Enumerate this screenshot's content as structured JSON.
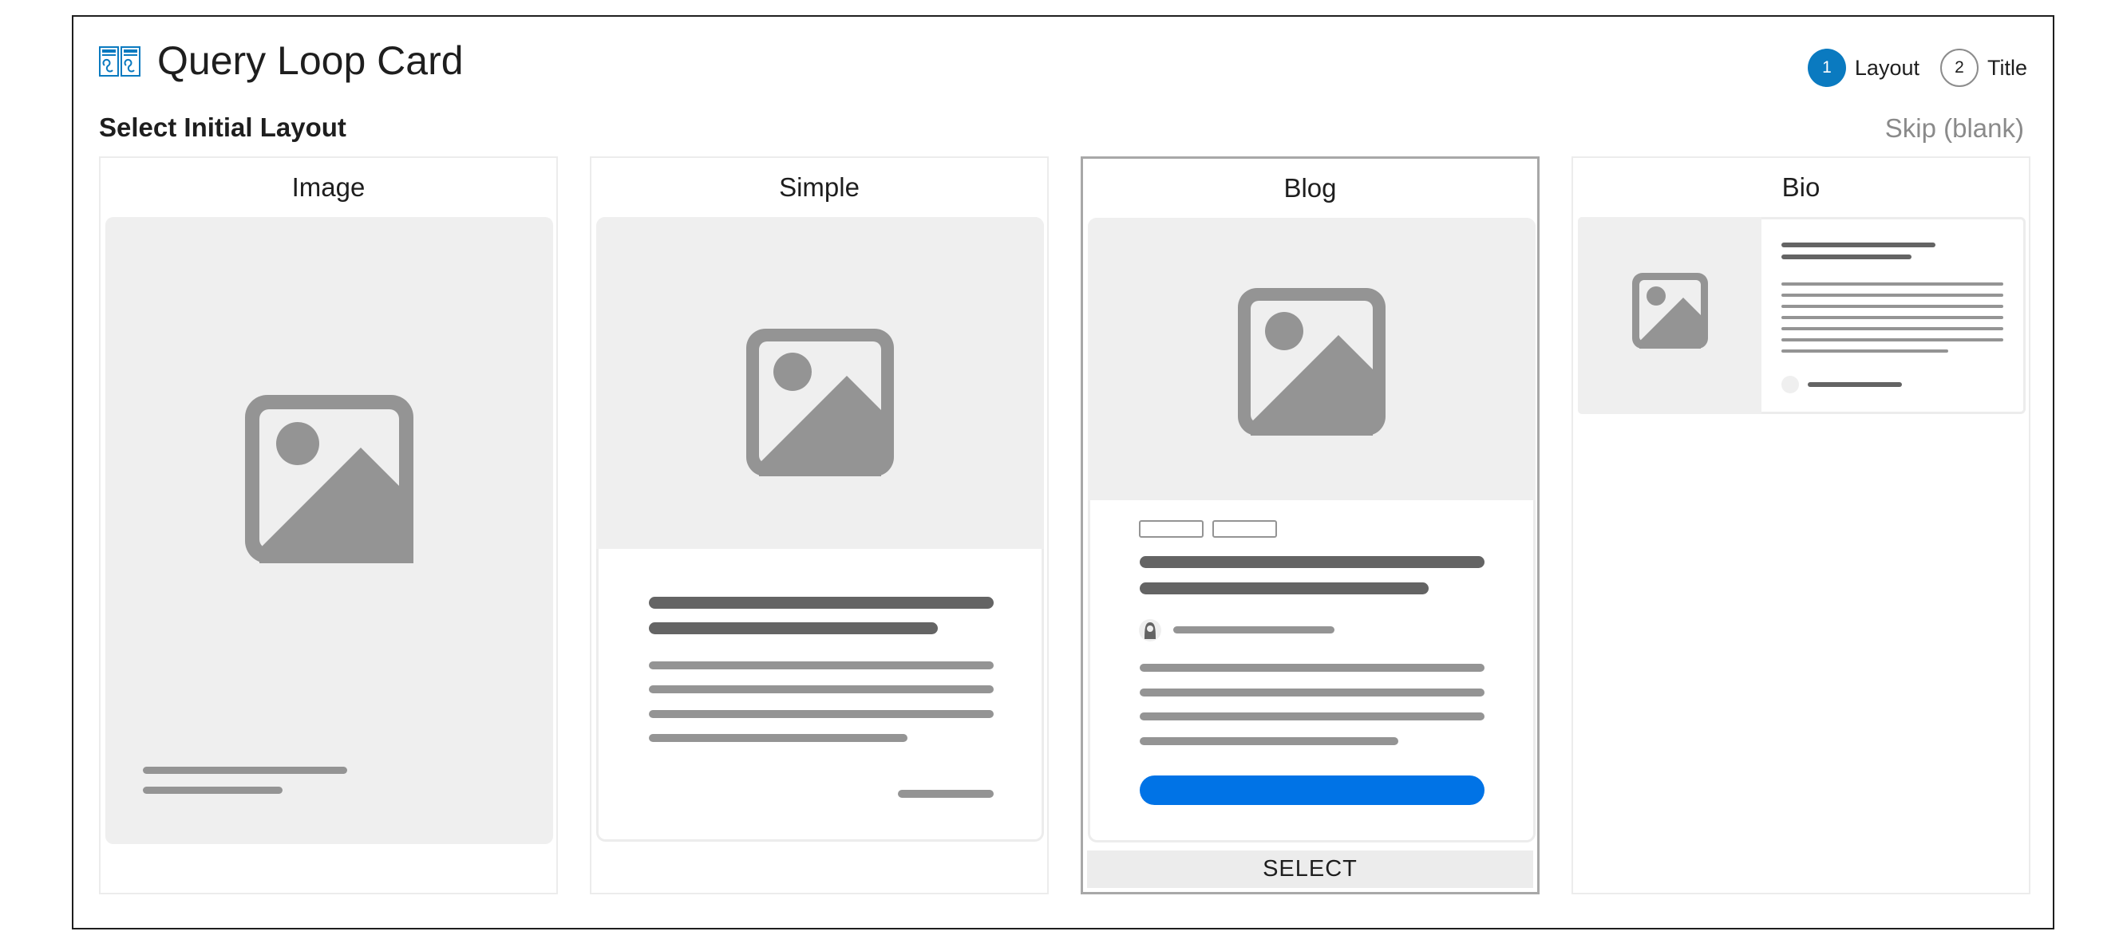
{
  "modal": {
    "title": "Query Loop Card",
    "header_icon": "query-loop-card-icon",
    "subtitle": "Select Initial Layout",
    "skip_label": "Skip (blank)"
  },
  "steps": [
    {
      "number": "1",
      "label": "Layout",
      "state": "active"
    },
    {
      "number": "2",
      "label": "Title",
      "state": "inactive"
    }
  ],
  "layouts": [
    {
      "name": "Image"
    },
    {
      "name": "Simple"
    },
    {
      "name": "Blog",
      "select_label": "SELECT"
    },
    {
      "name": "Bio"
    }
  ],
  "colors": {
    "accent": "#0a7ac0",
    "button_blue": "#0073e6",
    "placeholder_bg": "#efefef",
    "placeholder_icon": "#949494",
    "text_line_dark": "#646464",
    "text_line_light": "#949494"
  }
}
